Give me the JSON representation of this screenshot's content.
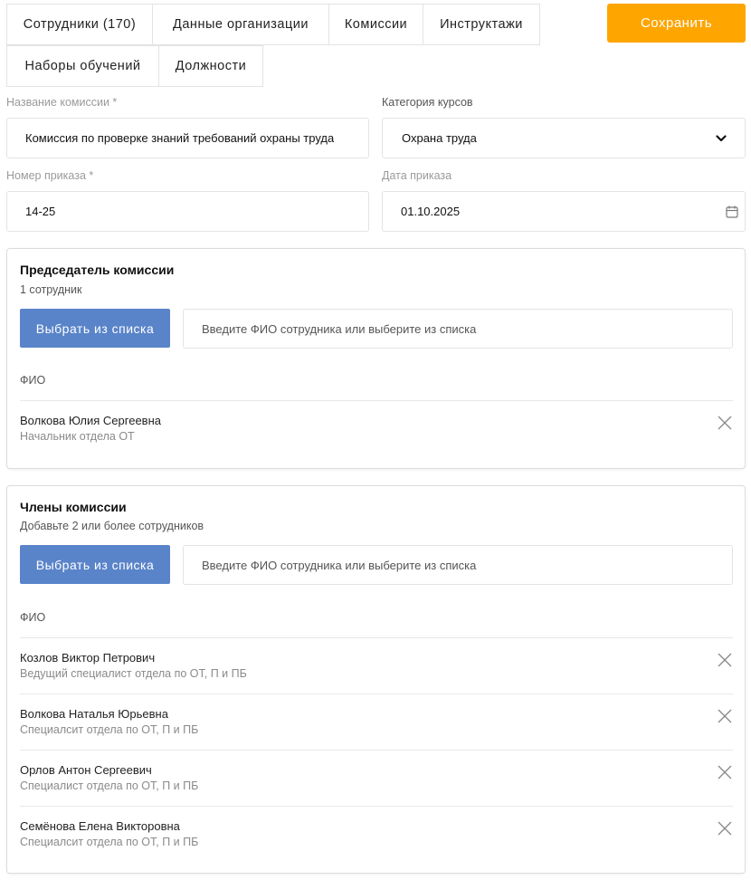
{
  "tabs": [
    {
      "label": "Сотрудники (170)"
    },
    {
      "label": "Данные организации"
    },
    {
      "label": "Комиссии"
    },
    {
      "label": "Инструктажи"
    },
    {
      "label": "Наборы обучений"
    },
    {
      "label": "Должности"
    }
  ],
  "save_label": "Сохранить",
  "form": {
    "commission_name": {
      "label": "Название комиссии *",
      "value": "Комиссия по проверке знаний требований охраны труда"
    },
    "course_category": {
      "label": "Категория курсов",
      "value": "Охрана труда",
      "icon": "chevron-down-icon"
    },
    "order_number": {
      "label": "Номер приказа *",
      "value": "14-25"
    },
    "order_date": {
      "label": "Дата приказа",
      "value": "01.10.2025",
      "icon": "calendar-icon"
    }
  },
  "chairman": {
    "title": "Председатель комиссии",
    "subtitle": "1 сотрудник",
    "pick_label": "Выбрать из списка",
    "search_placeholder": "Введите ФИО сотрудника или выберите из списка",
    "column": "ФИО",
    "people": [
      {
        "name": "Волкова Юлия Сергеевна",
        "position": "Начальник отдела ОТ"
      }
    ]
  },
  "members": {
    "title": "Члены комиссии",
    "subtitle": "Добавьте 2 или более сотрудников",
    "pick_label": "Выбрать из списка",
    "search_placeholder": "Введите ФИО сотрудника или выберите из списка",
    "column": "ФИО",
    "people": [
      {
        "name": "Козлов Виктор Петрович",
        "position": "Ведущий специалист отдела по ОТ, П и ПБ"
      },
      {
        "name": "Волкова Наталья Юрьевна",
        "position": "Специалсит отдела по ОТ, П и ПБ"
      },
      {
        "name": "Орлов Антон Сергеевич",
        "position": "Специалист отдела по ОТ, П и ПБ"
      },
      {
        "name": "Семёнова Елена Викторовна",
        "position": "Специалсит отдела по ОТ, П и ПБ"
      }
    ]
  },
  "colors": {
    "save_button": "#ffa500",
    "pick_button": "#5a84c9"
  }
}
